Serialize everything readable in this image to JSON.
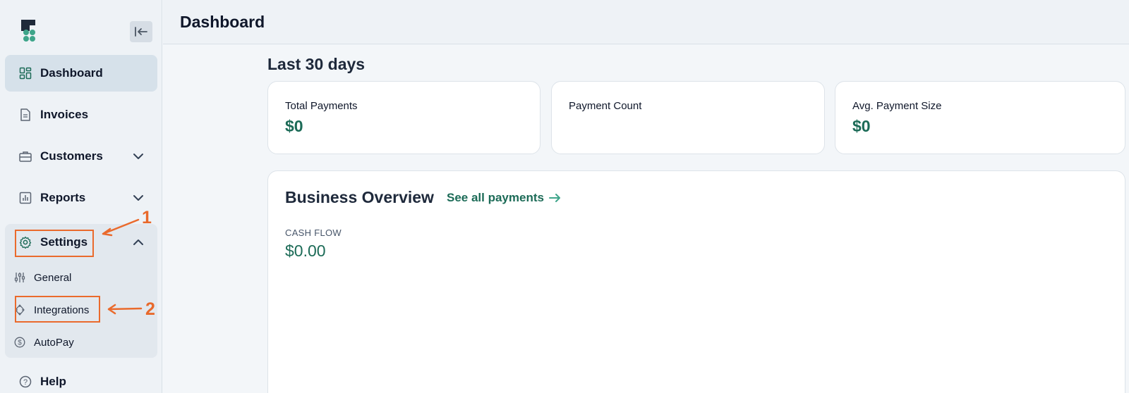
{
  "header": {
    "title": "Dashboard"
  },
  "sidebar": {
    "items": [
      {
        "label": "Dashboard"
      },
      {
        "label": "Invoices"
      },
      {
        "label": "Customers"
      },
      {
        "label": "Reports"
      },
      {
        "label": "Settings"
      },
      {
        "label": "Help"
      }
    ],
    "settings_sub": [
      {
        "label": "General"
      },
      {
        "label": "Integrations"
      },
      {
        "label": "AutoPay"
      }
    ]
  },
  "main": {
    "period_title": "Last 30 days",
    "cards": [
      {
        "label": "Total Payments",
        "value": "$0"
      },
      {
        "label": "Payment Count",
        "value": ""
      },
      {
        "label": "Avg. Payment Size",
        "value": "$0"
      }
    ],
    "overview": {
      "title": "Business Overview",
      "link": "See all payments",
      "cash_flow_label": "CASH FLOW",
      "cash_flow_value": "$0.00"
    }
  },
  "annotations": {
    "one": "1",
    "two": "2"
  },
  "colors": {
    "accent": "#1c6b57",
    "annotation": "#ea6a2c",
    "active_bg": "#d6e1ea"
  }
}
